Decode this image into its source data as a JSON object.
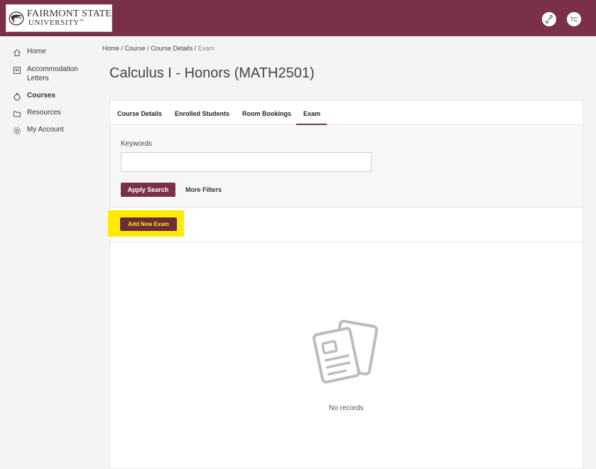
{
  "header": {
    "logo_line1": "FAIRMONT STATE",
    "logo_line2": "UNIVERSITY",
    "logo_tm": "™",
    "avatar_initials": "TC",
    "brand_color": "#7a3147",
    "icons": [
      "link-icon",
      "avatar"
    ]
  },
  "sidebar": {
    "items": [
      {
        "label": "Home",
        "icon": "home-icon"
      },
      {
        "label": "Accommodation",
        "label2": "Letters",
        "icon": "letters-icon"
      },
      {
        "label": "Courses",
        "icon": "courses-icon",
        "active": true
      },
      {
        "label": "Resources",
        "icon": "folder-icon"
      },
      {
        "label": "My Account",
        "icon": "gear-icon"
      }
    ]
  },
  "breadcrumb": {
    "home": "Home",
    "sep": " / ",
    "course": "Course",
    "course_details": "Course Details",
    "current": "Exam"
  },
  "page": {
    "title": "Calculus I - Honors (MATH2501)"
  },
  "tabs": [
    {
      "label": "Course Details"
    },
    {
      "label": "Enrolled Students"
    },
    {
      "label": "Room Bookings"
    },
    {
      "label": "Exam",
      "active": true
    }
  ],
  "filters": {
    "keywords_label": "Keywords",
    "keywords_value": "",
    "keywords_placeholder": "",
    "apply_label": "Apply Search",
    "more_filters_label": "More Filters"
  },
  "actions": {
    "add_exam_label": "Add New Exam",
    "highlight_color": "#ffeb00"
  },
  "empty_state": {
    "text": "No records",
    "icon": "documents-icon"
  }
}
